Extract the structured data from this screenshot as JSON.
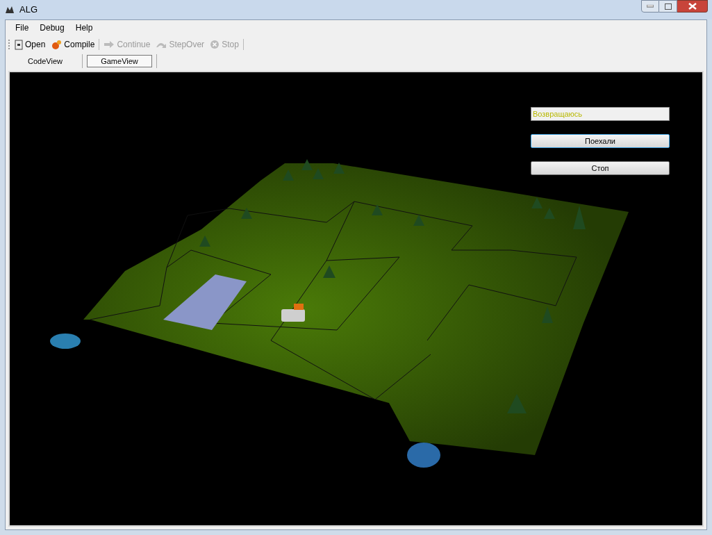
{
  "window": {
    "title": "ALG"
  },
  "menu": [
    "File",
    "Debug",
    "Help"
  ],
  "toolbar": [
    {
      "kind": "open",
      "label": "Open",
      "disabled": false
    },
    {
      "kind": "compile",
      "label": "Compile",
      "disabled": false
    },
    {
      "kind": "continue",
      "label": "Continue",
      "disabled": true
    },
    {
      "kind": "stepover",
      "label": "StepOver",
      "disabled": true
    },
    {
      "kind": "stop",
      "label": "Stop",
      "disabled": true
    }
  ],
  "tabs": [
    {
      "label": "CodeView",
      "selected": false
    },
    {
      "label": "GameView",
      "selected": true
    }
  ],
  "game": {
    "status": "Возвращаюсь",
    "buttons": [
      {
        "label": "Поехали",
        "focused": true
      },
      {
        "label": "Стоп",
        "focused": false
      }
    ]
  }
}
